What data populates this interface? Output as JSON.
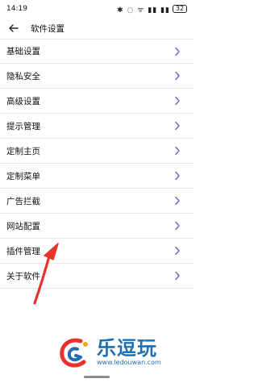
{
  "status_bar": {
    "time": "14:19",
    "icons": "✱ ◌ ᯤ ▮▮ ▮▮",
    "battery": "32"
  },
  "app_bar": {
    "title": "软件设置"
  },
  "menu": {
    "items": [
      {
        "label": "基础设置"
      },
      {
        "label": "隐私安全"
      },
      {
        "label": "高级设置"
      },
      {
        "label": "提示管理"
      },
      {
        "label": "定制主页"
      },
      {
        "label": "定制菜单"
      },
      {
        "label": "广告拦截"
      },
      {
        "label": "网站配置"
      },
      {
        "label": "插件管理"
      },
      {
        "label": "关于软件"
      }
    ]
  },
  "watermark": {
    "name": "乐逗玩",
    "url": "www.ledouwan.com"
  },
  "colors": {
    "chevron": "#6a60c8",
    "arrow": "#e8322b",
    "watermark": "#1f6fb3"
  }
}
